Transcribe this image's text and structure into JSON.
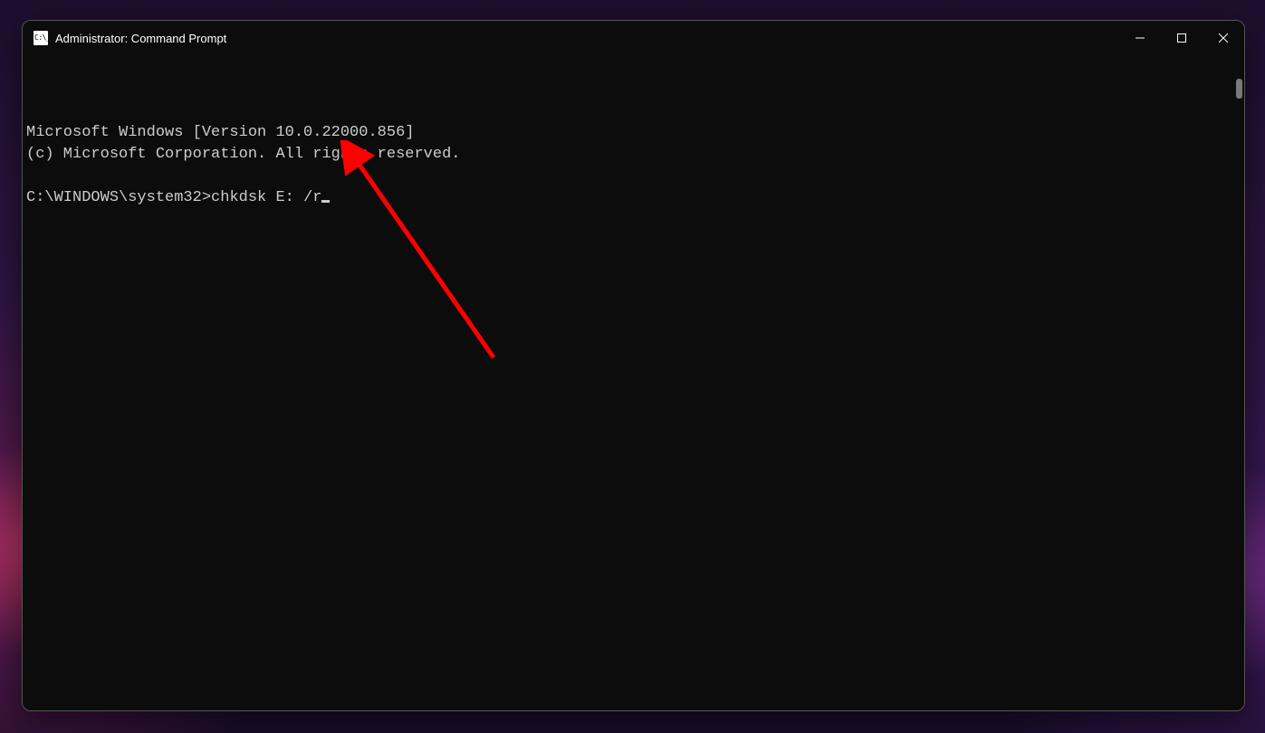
{
  "window": {
    "title": "Administrator: Command Prompt"
  },
  "terminal": {
    "line1": "Microsoft Windows [Version 10.0.22000.856]",
    "line2": "(c) Microsoft Corporation. All rights reserved.",
    "blank": "",
    "prompt": "C:\\WINDOWS\\system32>",
    "command": "chkdsk E: /r"
  },
  "annotation": {
    "color": "#ff0000"
  }
}
